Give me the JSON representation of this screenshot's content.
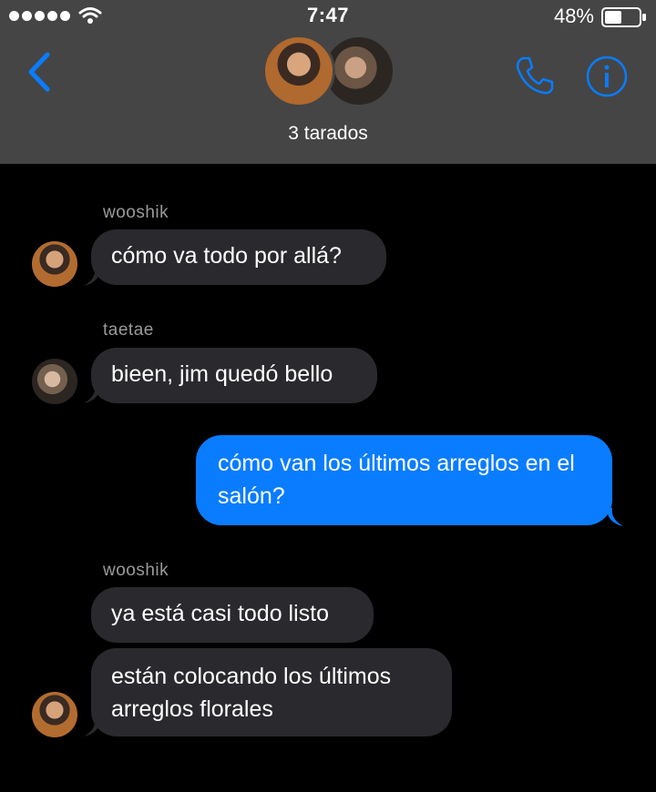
{
  "status": {
    "time": "7:47",
    "battery": "48%",
    "icons": [
      "signal-dots-icon",
      "wifi-icon",
      "battery-icon"
    ]
  },
  "header": {
    "group_name": "3 tarados",
    "icons": [
      "back-chevron-icon",
      "phone-icon",
      "info-icon"
    ]
  },
  "colors": {
    "header_bg": "#454545",
    "incoming_bubble": "#2a2a2e",
    "outgoing_bubble": "#0a7cff",
    "accent": "#0a7cff"
  },
  "messages": {
    "m1_sender": "wooshik",
    "m1_text": "cómo va todo por allá?",
    "m2_sender": "taetae",
    "m2_text": "bieen, jim quedó bello",
    "m3_text": "cómo van los últimos arreglos en el salón?",
    "m4_sender": "wooshik",
    "m4_text": "ya está casi todo listo",
    "m5_text": "están colocando los últimos arreglos florales"
  }
}
